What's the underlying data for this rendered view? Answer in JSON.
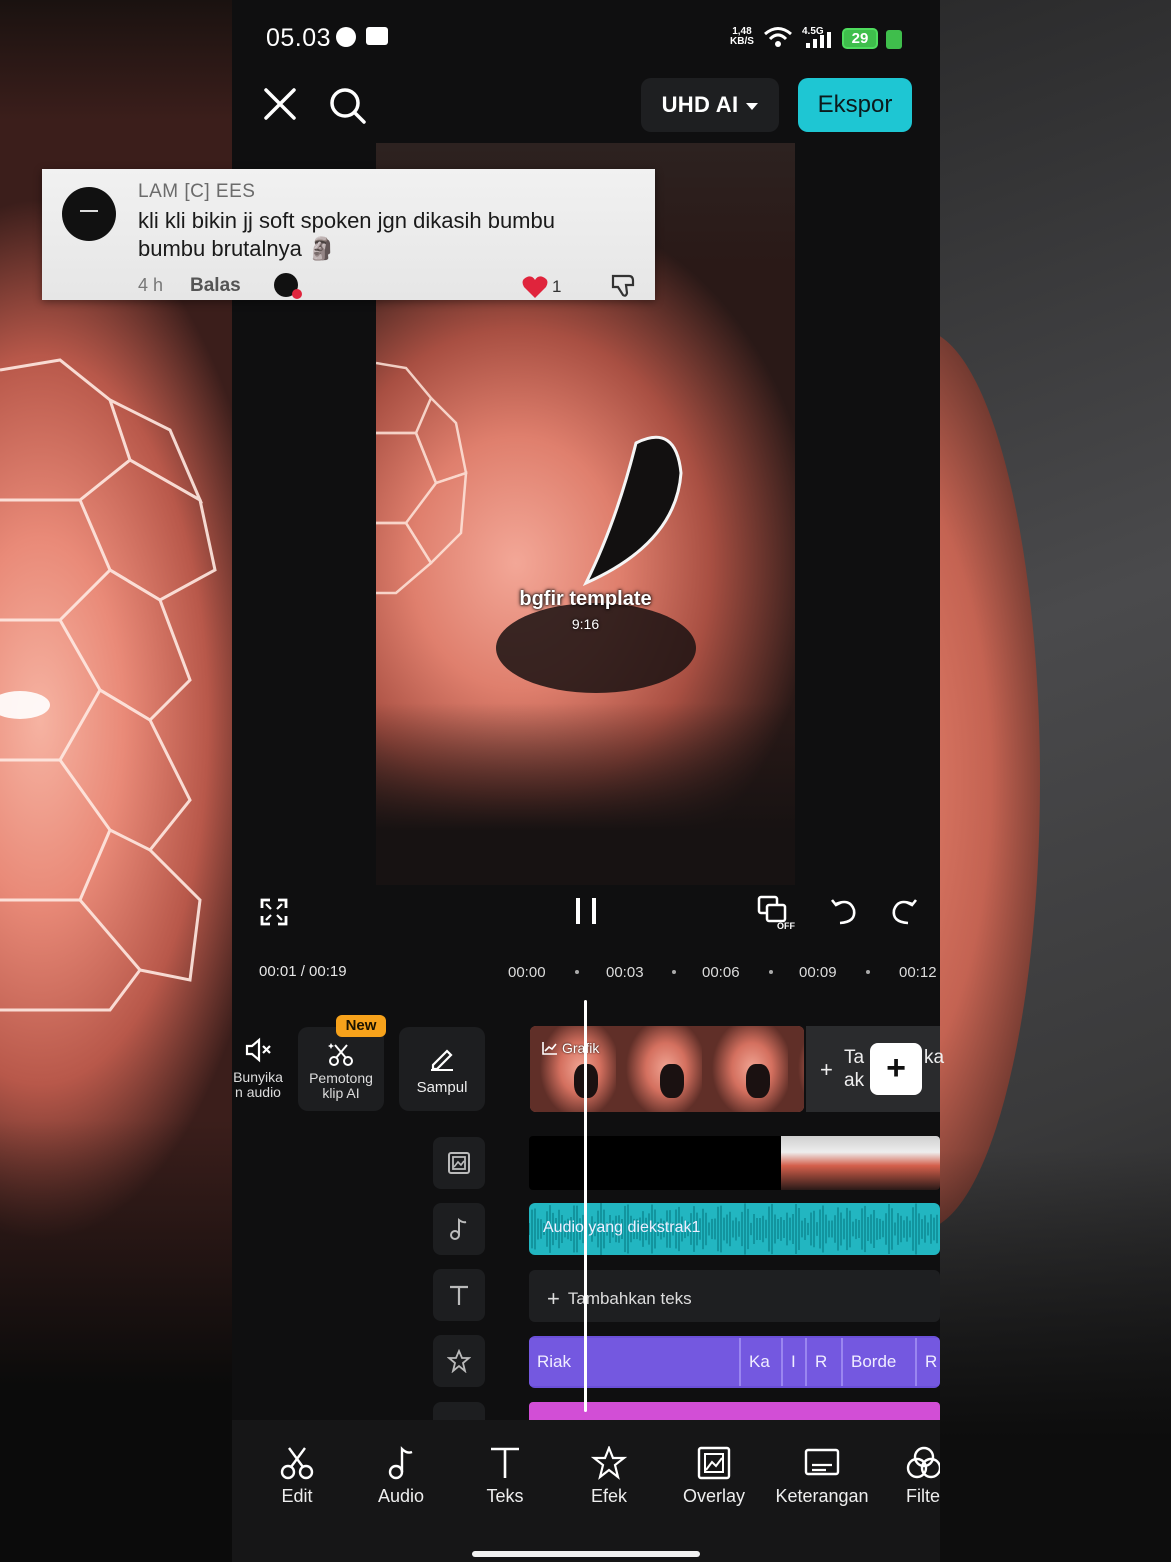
{
  "status_bar": {
    "time": "05.03",
    "net_speed_value": "1,48",
    "net_speed_unit": "KB/S",
    "signal_label": "4.5G",
    "battery_level": "29"
  },
  "toolbar": {
    "quality_label": "UHD AI",
    "export_label": "Ekspor"
  },
  "comment": {
    "username": "LAM [C] EES",
    "text": "kli kli bikin jj soft spoken jgn dikasih bumbu bumbu brutalnya 🗿",
    "time_ago": "4 h",
    "reply_label": "Balas",
    "like_count": "1"
  },
  "preview": {
    "template_label": "bgfir template",
    "aspect_ratio": "9:16"
  },
  "player": {
    "current_time": "00:01",
    "duration": "00:19",
    "timecode": "00:01 / 00:19",
    "ruler_ticks": [
      "00:00",
      "00:03",
      "00:06",
      "00:09",
      "00:12"
    ]
  },
  "tools": {
    "mute_label_line1": "Bunyika",
    "mute_label_line2": "n audio",
    "ai_cutter_badge": "New",
    "ai_cutter_line1": "Pemotong",
    "ai_cutter_line2": "klip AI",
    "cover_label": "Sampul"
  },
  "timeline": {
    "video_clip_label": "Grafik",
    "add_clip_line1": "Ta",
    "add_clip_line2": "ak",
    "add_clip_right": "ka",
    "audio_label": "Audio yang diekstrak1",
    "add_text_label": "Tambahkan teks",
    "effects": [
      "Riak",
      "Ka",
      "I",
      "R",
      "Borde",
      "R"
    ]
  },
  "bottom_nav": {
    "items": [
      "Edit",
      "Audio",
      "Teks",
      "Efek",
      "Overlay",
      "Keterangan",
      "Filte"
    ]
  },
  "colors": {
    "accent": "#1ec6d3",
    "audio_track": "#22b6c1",
    "effect_track": "#6a4fd8",
    "badge": "#f7a21b",
    "pink_track": "#d24ed6"
  }
}
